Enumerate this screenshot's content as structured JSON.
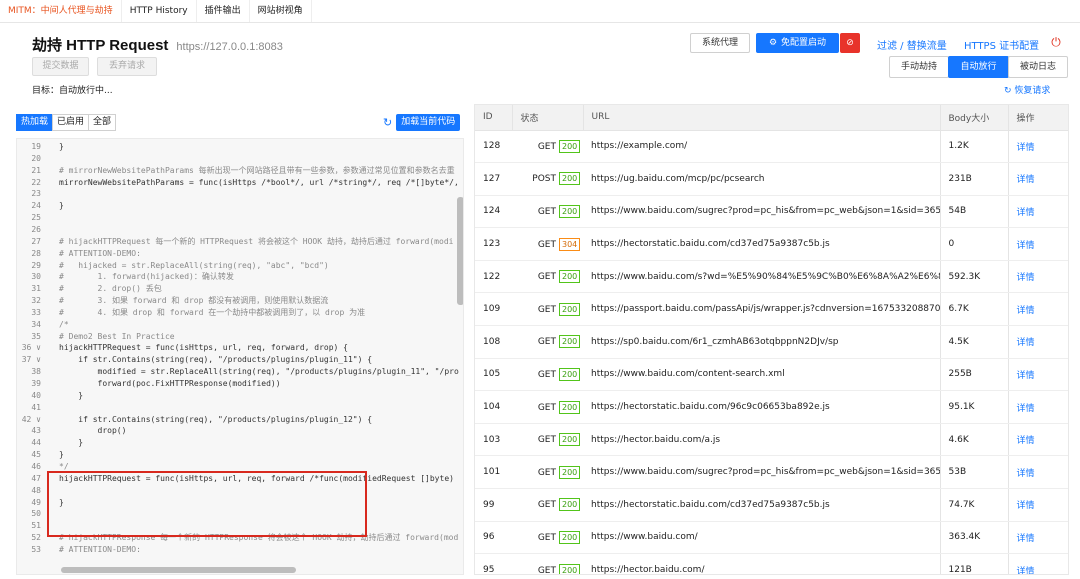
{
  "top_tabs": [
    {
      "label": "MITM：中间人代理与劫持",
      "active": true
    },
    {
      "label": "HTTP History",
      "active": false
    },
    {
      "label": "插件输出",
      "active": false
    },
    {
      "label": "网站树视角",
      "active": false
    }
  ],
  "header": {
    "title": "劫持 HTTP Request",
    "address": "https://127.0.0.1:8083",
    "submit_label": "提交数据",
    "discard_label": "丢弃请求",
    "target_label": "目标：自动放行中..."
  },
  "toolbar": {
    "system_proxy_label": "系统代理",
    "auto_config_label": "免配置启动",
    "filter_label": "过滤 / 替换流量",
    "https_cert_label": "HTTPS 证书配置",
    "manual_hijack_label": "手动劫持",
    "auto_release_label": "自动放行",
    "passive_log_label": "被动日志",
    "restore_request_label": "恢复请求"
  },
  "editor_toolbar": {
    "tabs": [
      {
        "label": "热加载",
        "active": true
      },
      {
        "label": "已启用",
        "active": false
      },
      {
        "label": "全部",
        "active": false
      }
    ],
    "reload_label": "加载当前代码"
  },
  "code_lines": [
    {
      "n": "19",
      "text": "}"
    },
    {
      "n": "20",
      "text": ""
    },
    {
      "n": "21",
      "text": "# mirrorNewWebsitePathParams 每新出现一个网站路径且带有一些参数，参数通过常见位置和参数名去重"
    },
    {
      "n": "22",
      "text": "mirrorNewWebsitePathParams = func(isHttps /*bool*/, url /*string*/, req /*[]byte*/,"
    },
    {
      "n": "23",
      "text": ""
    },
    {
      "n": "24",
      "text": "}"
    },
    {
      "n": "25",
      "text": ""
    },
    {
      "n": "26",
      "text": ""
    },
    {
      "n": "27",
      "text": "# hijackHTTPRequest 每一个新的 HTTPRequest 将会被这个 HOOK 劫持，劫持后通过 forward(modi"
    },
    {
      "n": "28",
      "text": "# ATTENTION-DEMO:"
    },
    {
      "n": "29",
      "text": "#   hijacked = str.ReplaceAll(string(req), \"abc\", \"bcd\")"
    },
    {
      "n": "30",
      "text": "#       1. forward(hijacked)：确认转发"
    },
    {
      "n": "31",
      "text": "#       2. drop() 丢包"
    },
    {
      "n": "32",
      "text": "#       3. 如果 forward 和 drop 都没有被调用，则使用默认数据流"
    },
    {
      "n": "33",
      "text": "#       4. 如果 drop 和 forward 在一个劫持中都被调用到了，以 drop 为准"
    },
    {
      "n": "34",
      "text": "/*"
    },
    {
      "n": "35",
      "text": "# Demo2 Best In Practice"
    },
    {
      "n": "36 ∨",
      "text": "hijackHTTPRequest = func(isHttps, url, req, forward, drop) {"
    },
    {
      "n": "37 ∨",
      "text": "    if str.Contains(string(req), \"/products/plugins/plugin_11\") {"
    },
    {
      "n": "38",
      "text": "        modified = str.ReplaceAll(string(req), \"/products/plugins/plugin_11\", \"/pro"
    },
    {
      "n": "39",
      "text": "        forward(poc.FixHTTPResponse(modified))"
    },
    {
      "n": "40",
      "text": "    }"
    },
    {
      "n": "41",
      "text": ""
    },
    {
      "n": "42 ∨",
      "text": "    if str.Contains(string(req), \"/products/plugins/plugin_12\") {"
    },
    {
      "n": "43",
      "text": "        drop()"
    },
    {
      "n": "44",
      "text": "    }"
    },
    {
      "n": "45",
      "text": "}"
    },
    {
      "n": "46",
      "text": "*/"
    },
    {
      "n": "47",
      "text": "hijackHTTPRequest = func(isHttps, url, req, forward /*func(modifiedRequest []byte)"
    },
    {
      "n": "48",
      "text": ""
    },
    {
      "n": "49",
      "text": "}"
    },
    {
      "n": "50",
      "text": ""
    },
    {
      "n": "51",
      "text": ""
    },
    {
      "n": "52",
      "text": "# hijackHTTPResponse 每一个新的 HTTPResponse 将会被这个 HOOK 劫持，劫持后通过 forward(mod"
    },
    {
      "n": "53",
      "text": "# ATTENTION-DEMO:"
    }
  ],
  "table": {
    "headers": [
      "ID",
      "状态",
      "URL",
      "Body大小",
      "操作"
    ],
    "rows": [
      {
        "id": "128",
        "method": "GET",
        "code": "200",
        "url": "https://example.com/",
        "size": "1.2K",
        "op": "详情"
      },
      {
        "id": "127",
        "method": "POST",
        "code": "200",
        "url": "https://ug.baidu.com/mcp/pc/pcsearch",
        "size": "231B",
        "op": "详情"
      },
      {
        "id": "124",
        "method": "GET",
        "code": "200",
        "url": "https://www.baidu.com/sugrec?prod=pc_his&from=pc_web&json=1&sid=36557_38093_3",
        "size": "54B",
        "op": "详情"
      },
      {
        "id": "123",
        "method": "GET",
        "code": "304",
        "url": "https://hectorstatic.baidu.com/cd37ed75a9387c5b.js",
        "size": "0",
        "op": "详情"
      },
      {
        "id": "122",
        "method": "GET",
        "code": "200",
        "url": "https://www.baidu.com/s?wd=%E5%90%84%E5%9C%B0%E6%8A%A2%E6%8A%93%E5",
        "size": "592.3K",
        "op": "详情"
      },
      {
        "id": "109",
        "method": "GET",
        "code": "200",
        "url": "https://passport.baidu.com/passApi/js/wrapper.js?cdnversion=1675332088707&_=16753",
        "size": "6.7K",
        "op": "详情"
      },
      {
        "id": "108",
        "method": "GET",
        "code": "200",
        "url": "https://sp0.baidu.com/6r1_czmhAB63otqbppnN2DJv/sp",
        "size": "4.5K",
        "op": "详情"
      },
      {
        "id": "105",
        "method": "GET",
        "code": "200",
        "url": "https://www.baidu.com/content-search.xml",
        "size": "255B",
        "op": "详情"
      },
      {
        "id": "104",
        "method": "GET",
        "code": "200",
        "url": "https://hectorstatic.baidu.com/96c9c06653ba892e.js",
        "size": "95.1K",
        "op": "详情"
      },
      {
        "id": "103",
        "method": "GET",
        "code": "200",
        "url": "https://hector.baidu.com/a.js",
        "size": "4.6K",
        "op": "详情"
      },
      {
        "id": "101",
        "method": "GET",
        "code": "200",
        "url": "https://www.baidu.com/sugrec?prod=pc_his&from=pc_web&json=1&sid=36551_38105_3",
        "size": "53B",
        "op": "详情"
      },
      {
        "id": "99",
        "method": "GET",
        "code": "200",
        "url": "https://hectorstatic.baidu.com/cd37ed75a9387c5b.js",
        "size": "74.7K",
        "op": "详情"
      },
      {
        "id": "96",
        "method": "GET",
        "code": "200",
        "url": "https://www.baidu.com/",
        "size": "363.4K",
        "op": "详情"
      },
      {
        "id": "95",
        "method": "GET",
        "code": "200",
        "url": "https://hector.baidu.com/",
        "size": "121B",
        "op": "详情"
      }
    ]
  }
}
